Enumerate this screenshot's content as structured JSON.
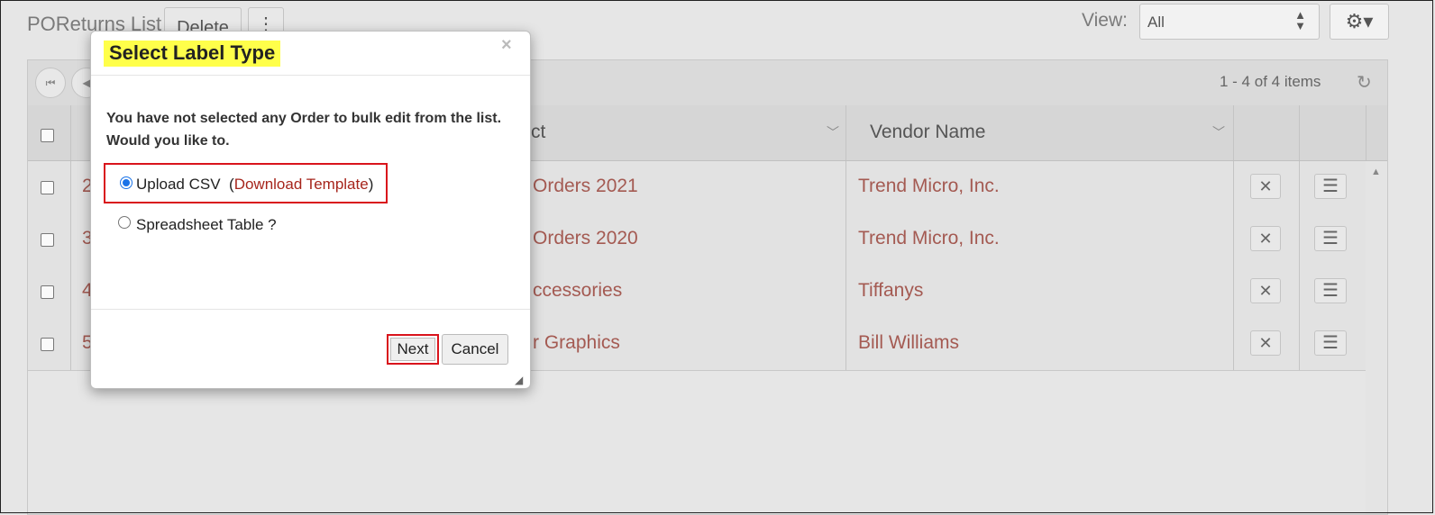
{
  "page": {
    "title": "POReturns List",
    "delete_label": "Delete",
    "more_glyph": "⋮",
    "view_label": "View:",
    "view_value": "All",
    "gear_glyph": "⚙▾"
  },
  "pager": {
    "info": "1 - 4 of 4 items",
    "first_glyph": "⏮",
    "prev_glyph": "◀",
    "refresh_glyph": "↻"
  },
  "columns": {
    "product_partial": "ct",
    "vendor": "Vendor Name"
  },
  "rows": [
    {
      "id_partial": "2",
      "product_partial": "Orders 2021",
      "vendor": "Trend Micro, Inc."
    },
    {
      "id_partial": "3",
      "product_partial": "Orders 2020",
      "vendor": "Trend Micro, Inc."
    },
    {
      "id_partial": "4",
      "product_partial": "ccessories",
      "vendor": "Tiffanys"
    },
    {
      "id_partial": "5",
      "product_partial": "r Graphics",
      "vendor": "Bill Williams"
    }
  ],
  "row_actions": {
    "remove_glyph": "✕",
    "menu_glyph": "☰"
  },
  "modal": {
    "title": "Select Label Type",
    "close_glyph": "×",
    "message": "You have not selected any Order to bulk edit from the list. Would you like to.",
    "option_upload": "Upload CSV",
    "paren_open": "(",
    "download_template": "Download Template",
    "paren_close": ")",
    "option_spreadsheet": "Spreadsheet Table ?",
    "next_label": "Next",
    "cancel_label": "Cancel",
    "resize_glyph": "◢"
  },
  "colors": {
    "link": "#a45a52",
    "highlight": "#ffff4a",
    "annotation_red": "#d9141c"
  }
}
